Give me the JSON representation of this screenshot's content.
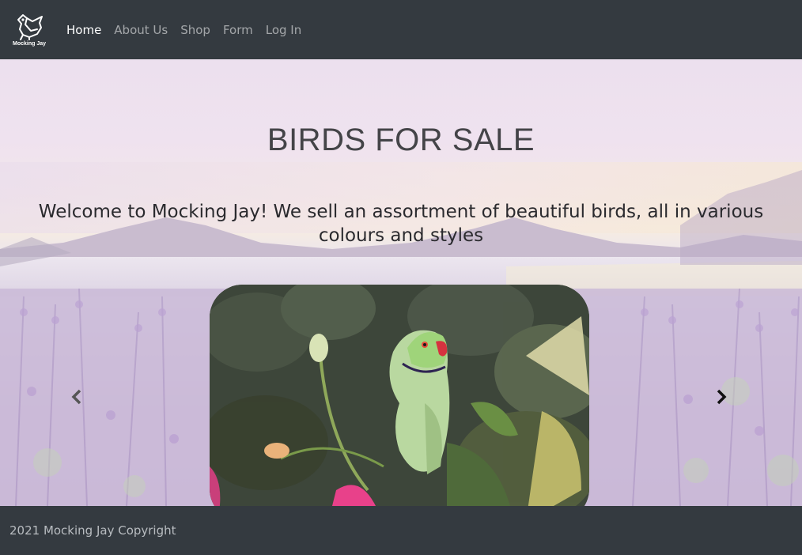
{
  "brand": {
    "name": "Mocking Jay",
    "logo_icon": "mockingjay-bird-icon"
  },
  "nav": {
    "items": [
      {
        "label": "Home",
        "active": true
      },
      {
        "label": "About Us",
        "active": false
      },
      {
        "label": "Shop",
        "active": false
      },
      {
        "label": "Form",
        "active": false
      },
      {
        "label": "Log In",
        "active": false
      }
    ]
  },
  "hero": {
    "title": "BIRDS FOR SALE",
    "subtitle": "Welcome to Mocking Jay! We sell an assortment of beautiful birds, all in various colours and styles"
  },
  "carousel": {
    "prev_icon": "chevron-left-icon",
    "next_icon": "chevron-right-icon"
  },
  "footer": {
    "text": "2021 Mocking Jay Copyright"
  },
  "colors": {
    "navbar": "#343a40",
    "footer": "#343a40",
    "nav_active": "#ffffff",
    "nav_inactive": "rgba(255,255,255,0.55)"
  }
}
